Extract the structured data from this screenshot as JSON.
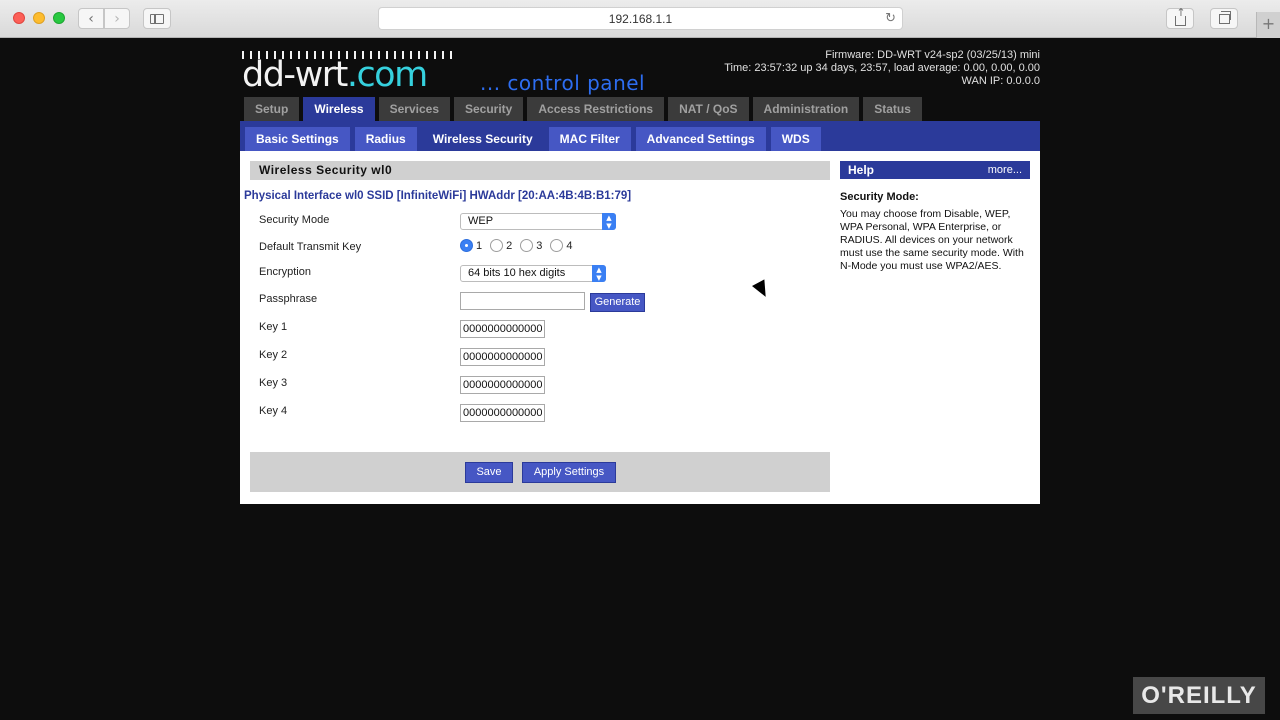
{
  "browser": {
    "url": "192.168.1.1",
    "back_icon": "‹",
    "forward_icon": "›",
    "reload_icon": "↻",
    "newtab_icon": "+"
  },
  "logo": {
    "main": "dd-wrt",
    "domain": ".com",
    "tagline": "... control panel"
  },
  "firmware_info": {
    "firmware": "Firmware: DD-WRT v24-sp2 (03/25/13) mini",
    "time": "Time: 23:57:32 up 34 days, 23:57, load average: 0.00, 0.00, 0.00",
    "wan_ip": "WAN IP: 0.0.0.0"
  },
  "main_nav": [
    {
      "label": "Setup"
    },
    {
      "label": "Wireless"
    },
    {
      "label": "Services"
    },
    {
      "label": "Security"
    },
    {
      "label": "Access Restrictions"
    },
    {
      "label": "NAT / QoS"
    },
    {
      "label": "Administration"
    },
    {
      "label": "Status"
    }
  ],
  "sub_nav": [
    {
      "label": "Basic Settings"
    },
    {
      "label": "Radius"
    },
    {
      "label": "Wireless Security"
    },
    {
      "label": "MAC Filter"
    },
    {
      "label": "Advanced Settings"
    },
    {
      "label": "WDS"
    }
  ],
  "section": {
    "title": "Wireless Security wl0",
    "interface": "Physical Interface wl0 SSID [InfiniteWiFi] HWAddr [20:AA:4B:4B:B1:79]"
  },
  "form": {
    "security_mode_label": "Security Mode",
    "security_mode_value": "WEP",
    "default_key_label": "Default Transmit Key",
    "default_key_options": [
      "1",
      "2",
      "3",
      "4"
    ],
    "default_key_selected": "1",
    "encryption_label": "Encryption",
    "encryption_value": "64 bits 10 hex digits",
    "passphrase_label": "Passphrase",
    "passphrase_value": "",
    "generate_label": "Generate",
    "keys": [
      {
        "label": "Key 1",
        "value": "0000000000000"
      },
      {
        "label": "Key 2",
        "value": "0000000000000"
      },
      {
        "label": "Key 3",
        "value": "0000000000000"
      },
      {
        "label": "Key 4",
        "value": "0000000000000"
      }
    ],
    "save_label": "Save",
    "apply_label": "Apply Settings"
  },
  "help": {
    "header": "Help",
    "more": "more...",
    "title": "Security Mode:",
    "text": "You may choose from Disable, WEP, WPA Personal, WPA Enterprise, or RADIUS. All devices on your network must use the same security mode. With N-Mode you must use WPA2/AES."
  },
  "watermark": "O'REILLY",
  "colors": {
    "nav_active": "#2b3a9a",
    "subnav_tab": "#4657c4",
    "logo_accent": "#36d1de",
    "select_accent": "#3a7ff3"
  }
}
